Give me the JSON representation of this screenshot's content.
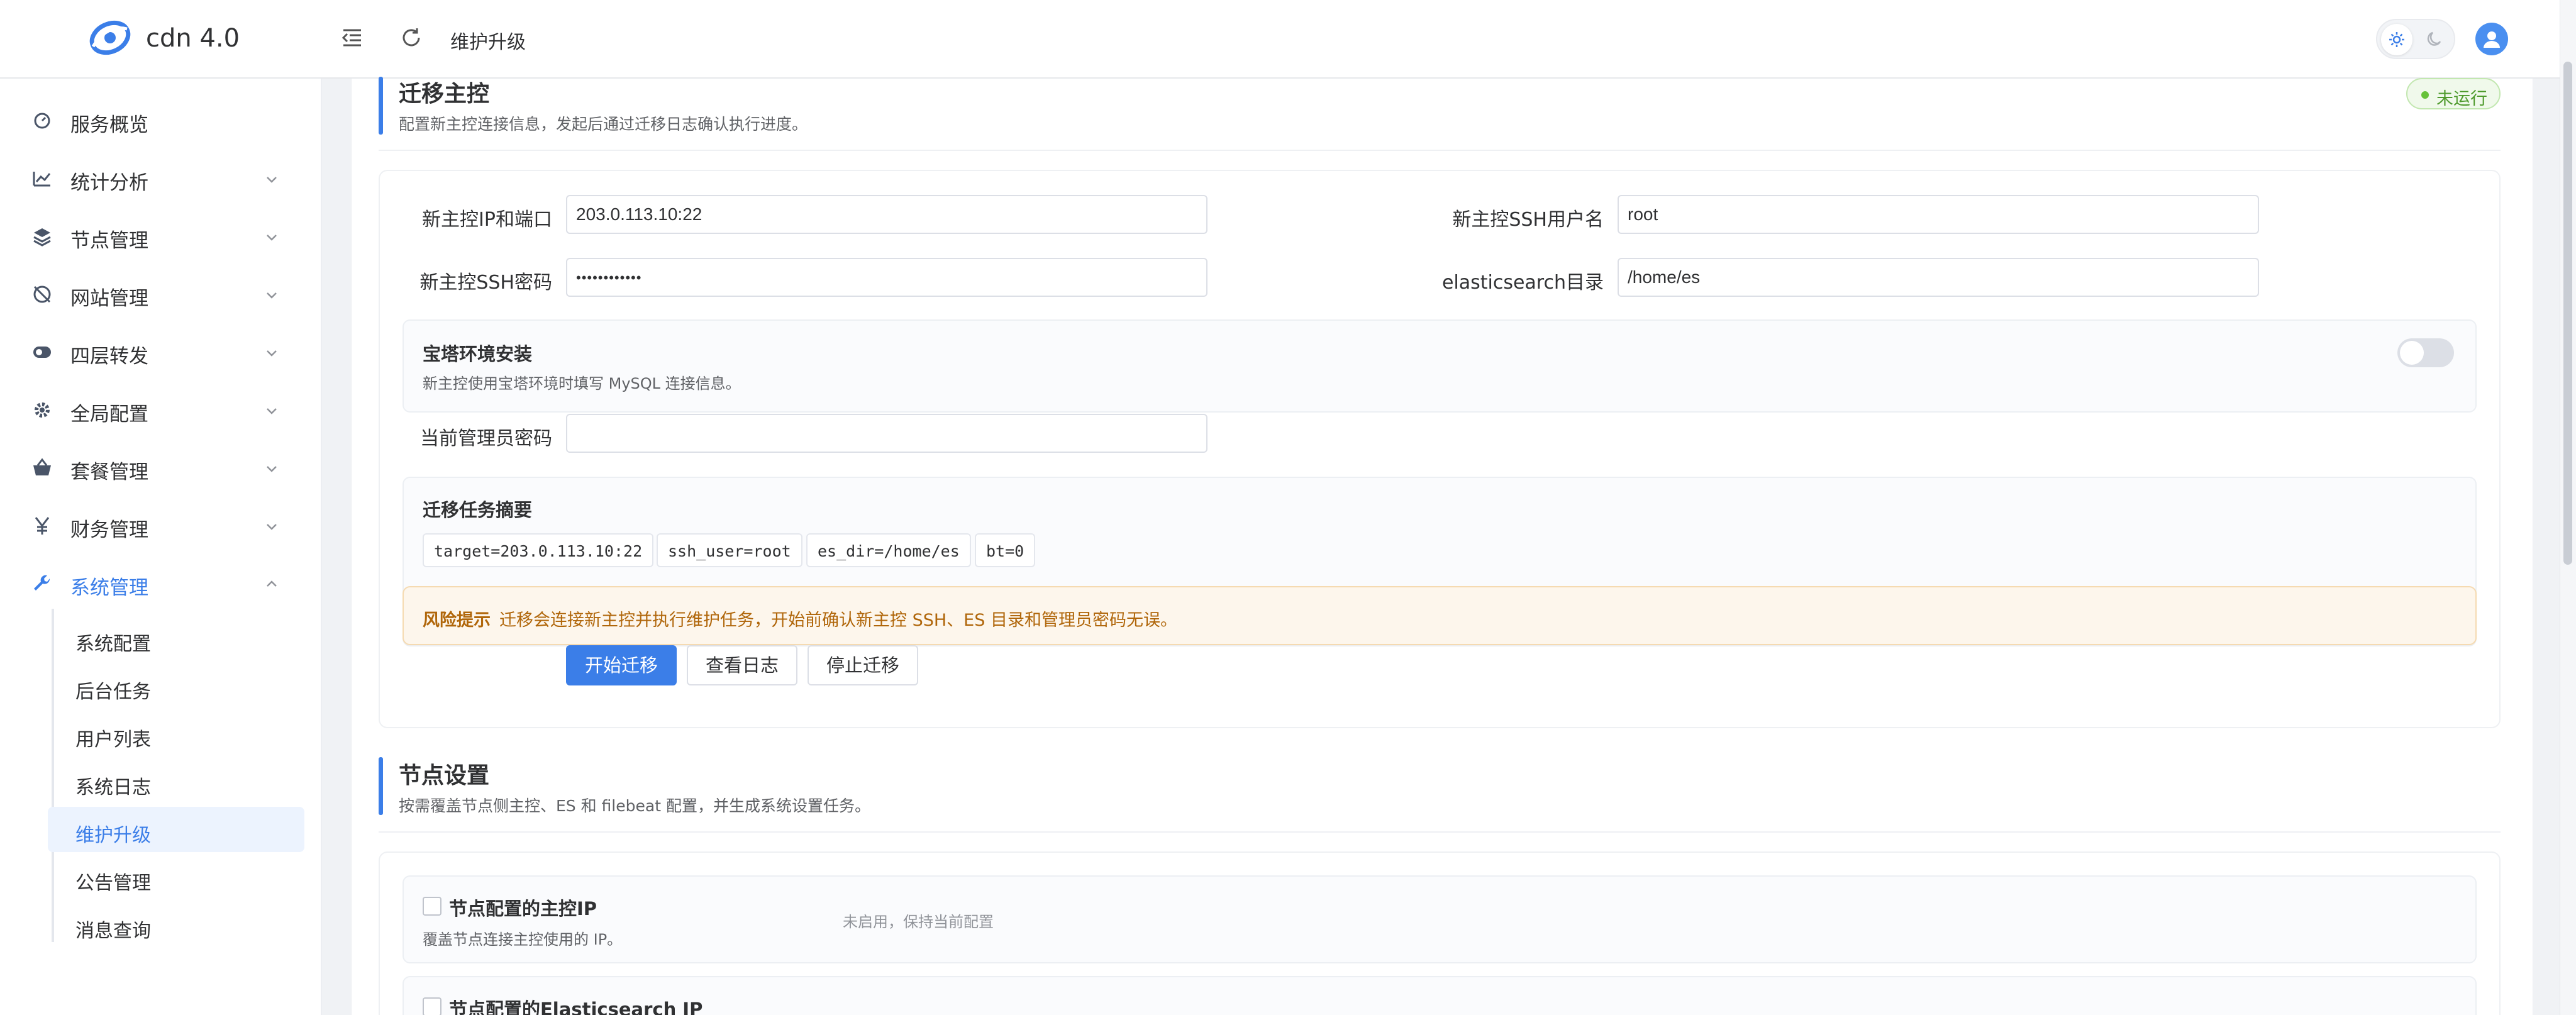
{
  "app": {
    "brand": "cdn 4.0"
  },
  "header": {
    "breadcrumb": "维护升级"
  },
  "sidebar": {
    "items": [
      {
        "label": "服务概览",
        "icon": "dashboard-icon"
      },
      {
        "label": "统计分析",
        "icon": "chart-icon"
      },
      {
        "label": "节点管理",
        "icon": "layers-icon"
      },
      {
        "label": "网站管理",
        "icon": "globe-icon"
      },
      {
        "label": "四层转发",
        "icon": "forward-icon"
      },
      {
        "label": "全局配置",
        "icon": "gear-icon"
      },
      {
        "label": "套餐管理",
        "icon": "basket-icon"
      },
      {
        "label": "财务管理",
        "icon": "yen-icon"
      },
      {
        "label": "系统管理",
        "icon": "wrench-icon"
      }
    ],
    "sub_items": [
      {
        "label": "系统配置"
      },
      {
        "label": "后台任务"
      },
      {
        "label": "用户列表"
      },
      {
        "label": "系统日志"
      },
      {
        "label": "维护升级"
      },
      {
        "label": "公告管理"
      },
      {
        "label": "消息查询"
      }
    ]
  },
  "migrate": {
    "title": "迁移主控",
    "desc": "配置新主控连接信息，发起后通过迁移日志确认执行进度。",
    "status": "未运行",
    "fields": {
      "ip_label": "新主控IP和端口",
      "ip_value": "203.0.113.10:22",
      "user_label": "新主控SSH用户名",
      "user_value": "root",
      "pw_label": "新主控SSH密码",
      "pw_value": "••••••••••••",
      "es_label": "elasticsearch目录",
      "es_value": "/home/es",
      "admin_pw_label": "当前管理员密码",
      "admin_pw_value": ""
    },
    "bt": {
      "title": "宝塔环境安装",
      "desc": "新主控使用宝塔环境时填写 MySQL 连接信息。"
    },
    "summary": {
      "title": "迁移任务摘要",
      "tags": [
        "target=203.0.113.10:22",
        "ssh_user=root",
        "es_dir=/home/es",
        "bt=0"
      ]
    },
    "risk": {
      "label": "风险提示",
      "text": "迁移会连接新主控并执行维护任务，开始前确认新主控 SSH、ES 目录和管理员密码无误。"
    },
    "buttons": {
      "start": "开始迁移",
      "log": "查看日志",
      "stop": "停止迁移"
    }
  },
  "node": {
    "title": "节点设置",
    "desc": "按需覆盖节点侧主控、ES 和 filebeat 配置，并生成系统设置任务。",
    "rows": [
      {
        "title": "节点配置的主控IP",
        "desc": "覆盖节点连接主控使用的 IP。",
        "state": "未启用，保持当前配置"
      },
      {
        "title": "节点配置的Elasticsearch IP"
      }
    ]
  },
  "colors": {
    "accent": "#3b7ee8",
    "success": "#67c23a",
    "warning": "#b0660a"
  }
}
